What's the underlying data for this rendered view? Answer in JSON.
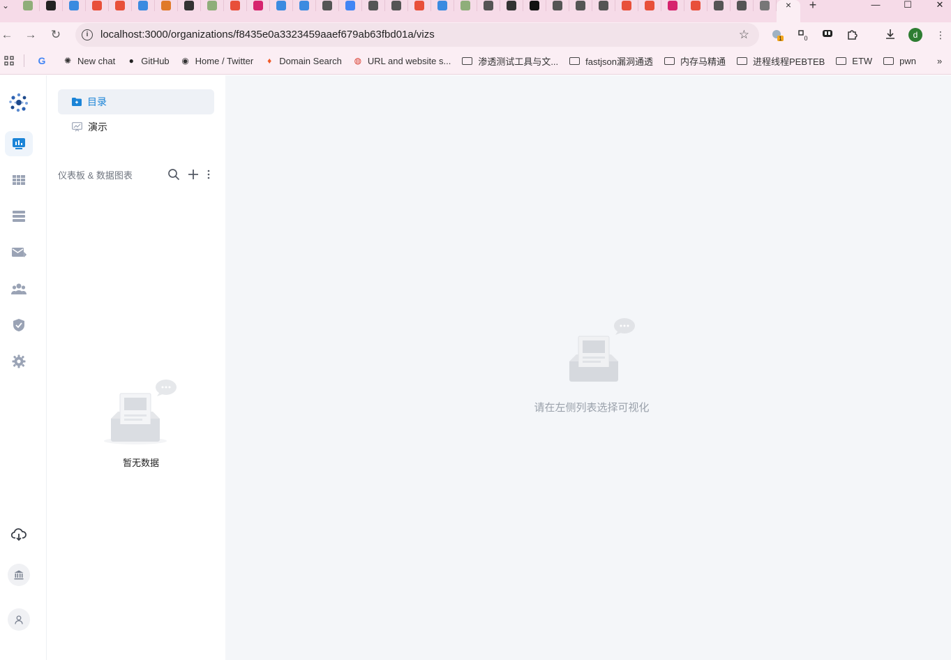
{
  "browser": {
    "active_tab_close": "×",
    "new_tab": "+",
    "url": "localhost:3000/organizations/f8435e0a3323459aaef679ab63fbd01a/vizs",
    "profile_initial": "d",
    "ext_badge_1": "1",
    "ext_badge_2": "0",
    "tab_favicon_colors": [
      "#8fae7a",
      "#222222",
      "#3b8be0",
      "#e8503a",
      "#e8503a",
      "#3b8be0",
      "#e07a2a",
      "#333333",
      "#8fae7a",
      "#e8503a",
      "#d6246e",
      "#3b8be0",
      "#3b8be0",
      "#555555",
      "#4285f4",
      "#555555",
      "#555555",
      "#e8503a",
      "#3b8be0",
      "#8fae7a",
      "#555555",
      "#333333",
      "#111111",
      "#555555",
      "#555555",
      "#555555",
      "#e8503a",
      "#e8503a",
      "#d6246e",
      "#e8503a",
      "#555555",
      "#555555",
      "#777777"
    ]
  },
  "bookmarks": [
    {
      "label": "New chat",
      "icon": "openai-icon"
    },
    {
      "label": "GitHub",
      "icon": "github-icon"
    },
    {
      "label": "Home / Twitter",
      "icon": "globe-icon"
    },
    {
      "label": "Domain Search",
      "icon": "fire-icon"
    },
    {
      "label": "URL and website s...",
      "icon": "scanner-icon"
    },
    {
      "label": "渗透测试工具与文...",
      "icon": "folder-icon"
    },
    {
      "label": "fastjson漏洞通透",
      "icon": "folder-icon"
    },
    {
      "label": "内存马精通",
      "icon": "folder-icon"
    },
    {
      "label": "进程线程PEBTEB",
      "icon": "folder-icon"
    },
    {
      "label": "ETW",
      "icon": "folder-icon"
    },
    {
      "label": "pwn",
      "icon": "folder-icon"
    }
  ],
  "sidebar": {
    "tabs": [
      {
        "label": "目录",
        "active": true
      },
      {
        "label": "演示",
        "active": false
      }
    ],
    "list_title": "仪表板 & 数据图表",
    "empty_text": "暂无数据"
  },
  "main": {
    "empty_text": "请在左侧列表选择可视化"
  },
  "colors": {
    "accent": "#1b84d7",
    "rail_icon": "#9aa3b5",
    "main_bg": "#f4f6f9"
  }
}
